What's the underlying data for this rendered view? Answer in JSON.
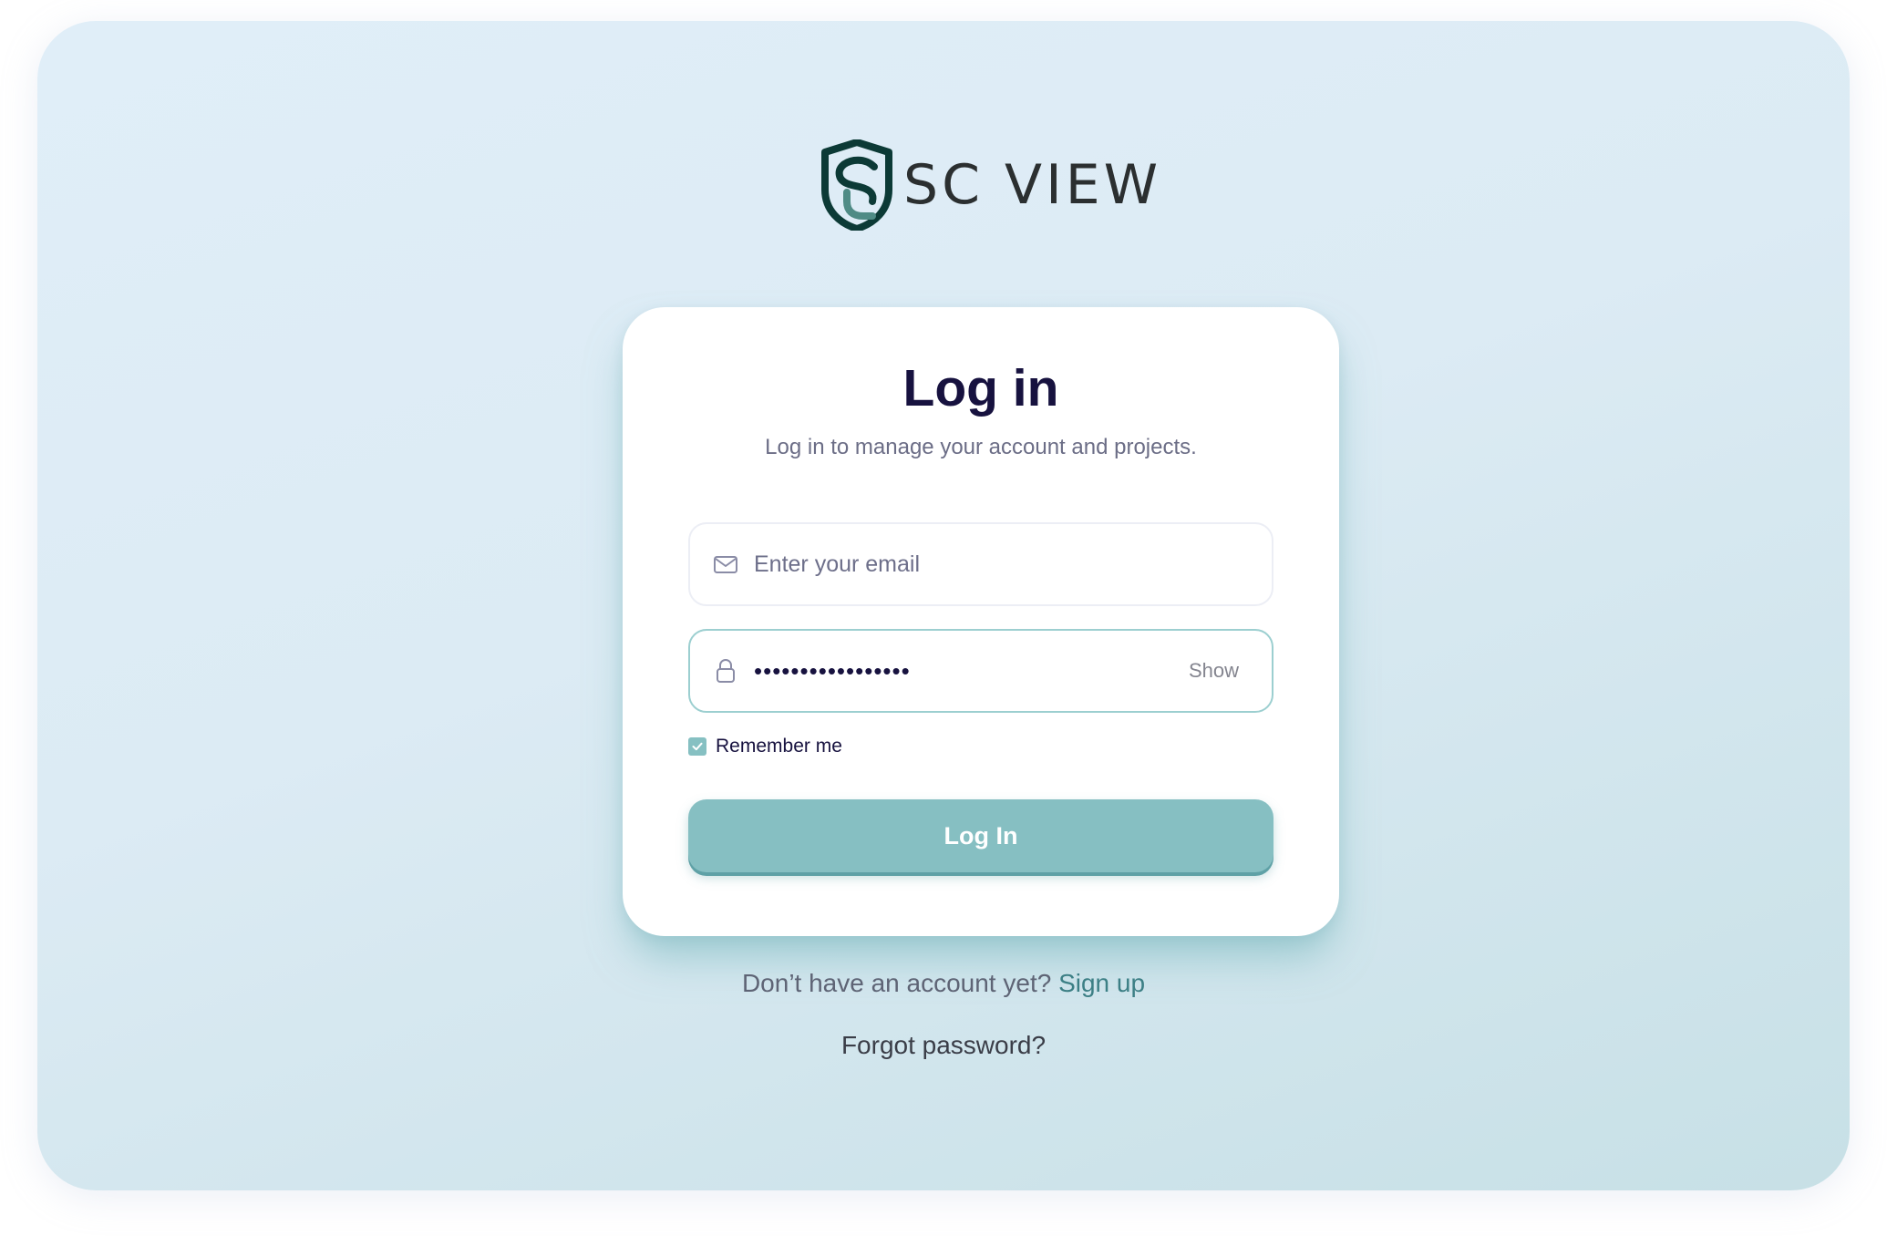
{
  "brand": {
    "name": "SC VIEW"
  },
  "login_card": {
    "title": "Log in",
    "subtitle": "Log in to manage your account and projects."
  },
  "email_field": {
    "placeholder": "Enter your email",
    "value": "",
    "icon": "mail-icon"
  },
  "password_field": {
    "value": "•••••••••••••••••",
    "icon": "lock-icon",
    "toggle_label": "Show"
  },
  "remember_me": {
    "label": "Remember me",
    "checked": true
  },
  "login_button": {
    "label": "Log In"
  },
  "footer": {
    "signup_prompt": "Don’t have an account yet?",
    "signup_link": "Sign up",
    "forgot_password": "Forgot password?"
  },
  "colors": {
    "accent": "#86bfc2",
    "heading": "#17123f",
    "link": "#3c7f85",
    "logo_dark": "#0c3a36",
    "logo_light": "#4f8b85"
  }
}
